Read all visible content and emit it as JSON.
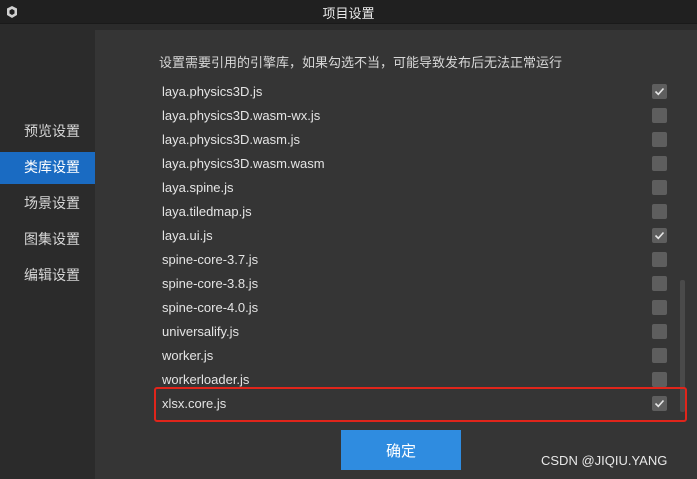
{
  "window": {
    "title": "项目设置"
  },
  "sidebar": {
    "items": [
      {
        "label": "预览设置",
        "active": false
      },
      {
        "label": "类库设置",
        "active": true
      },
      {
        "label": "场景设置",
        "active": false
      },
      {
        "label": "图集设置",
        "active": false
      },
      {
        "label": "编辑设置",
        "active": false
      }
    ]
  },
  "main": {
    "description": "设置需要引用的引擎库，如果勾选不当，可能导致发布后无法正常运行",
    "libraries": [
      {
        "name": "laya.physics3D.js",
        "checked": true
      },
      {
        "name": "laya.physics3D.wasm-wx.js",
        "checked": false
      },
      {
        "name": "laya.physics3D.wasm.js",
        "checked": false
      },
      {
        "name": "laya.physics3D.wasm.wasm",
        "checked": false
      },
      {
        "name": "laya.spine.js",
        "checked": false
      },
      {
        "name": "laya.tiledmap.js",
        "checked": false
      },
      {
        "name": "laya.ui.js",
        "checked": true
      },
      {
        "name": "spine-core-3.7.js",
        "checked": false
      },
      {
        "name": "spine-core-3.8.js",
        "checked": false
      },
      {
        "name": "spine-core-4.0.js",
        "checked": false
      },
      {
        "name": "universalify.js",
        "checked": false
      },
      {
        "name": "worker.js",
        "checked": false
      },
      {
        "name": "workerloader.js",
        "checked": false
      },
      {
        "name": "xlsx.core.js",
        "checked": true
      }
    ],
    "confirm_label": "确定"
  },
  "watermark": "CSDN @JIQIU.YANG",
  "colors": {
    "accent": "#1a6bc2",
    "button": "#2f8ce0",
    "highlight": "#e0251b"
  }
}
